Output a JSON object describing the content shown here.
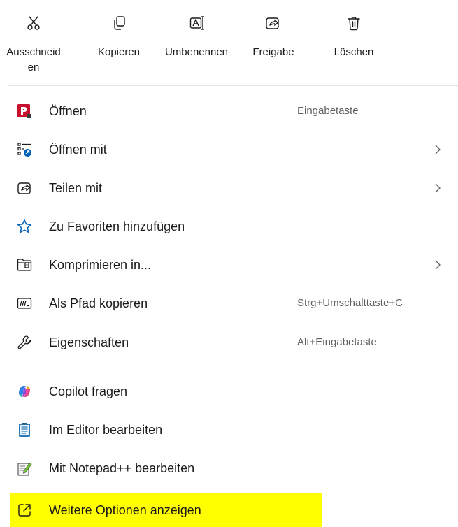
{
  "toolbar": {
    "cut_label": "Ausschneiden",
    "copy_label": "Kopieren",
    "rename_label": "Umbenennen",
    "share_label": "Freigabe",
    "delete_label": "Löschen"
  },
  "menu": {
    "open": {
      "label": "Öffnen",
      "shortcut": "Eingabetaste",
      "icon": "pdf-app-icon"
    },
    "open_with": {
      "label": "Öffnen mit",
      "icon": "open-with-icon"
    },
    "share_with": {
      "label": "Teilen mit",
      "icon": "share-icon"
    },
    "favorites": {
      "label": "Zu Favoriten hinzufügen",
      "icon": "star-icon"
    },
    "compress": {
      "label": "Komprimieren in...",
      "icon": "zip-folder-icon"
    },
    "copy_path": {
      "label": "Als Pfad kopieren",
      "shortcut": "Strg+Umschalttaste+C",
      "icon": "path-icon"
    },
    "properties": {
      "label": "Eigenschaften",
      "shortcut": "Alt+Eingabetaste",
      "icon": "wrench-icon"
    },
    "copilot": {
      "label": "Copilot fragen",
      "icon": "copilot-icon"
    },
    "editor": {
      "label": "Im Editor bearbeiten",
      "icon": "notepad-icon"
    },
    "notepadpp": {
      "label": "Mit Notepad++ bearbeiten",
      "icon": "notepad-plus-plus-icon"
    },
    "more_options": {
      "label": "Weitere Optionen anzeigen",
      "icon": "external-link-icon",
      "highlight": "#ffff00"
    }
  },
  "colors": {
    "accent": "#005fb8",
    "highlight": "#ffff00",
    "pdf_red": "#c8102e"
  }
}
